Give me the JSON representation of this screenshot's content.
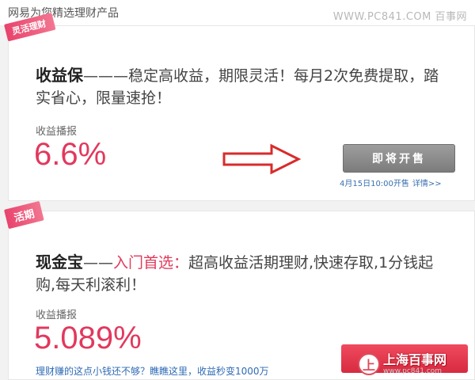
{
  "header": {
    "title": "网易为您精选理财产品",
    "watermark": "WWW.PC841.COM 百事网"
  },
  "products": [
    {
      "tag": "灵活理财",
      "name": "收益保",
      "dash": "———",
      "highlight": "",
      "description": "稳定高收益，期限灵活！每月2次免费提取，踏实省心，限量速抢！",
      "stat_label": "收益播报",
      "stat_value": "6.6%",
      "button_label": "即将开售",
      "sale_time": "4月15日10:00开售",
      "detail_link": "详情>>",
      "arrow_icon": "right-arrow-icon"
    },
    {
      "tag": "活期",
      "name": "现金宝",
      "dash": "——",
      "highlight": "入门首选：",
      "description": "超高收益活期理财,快速存取,1分钱起购,每天利滚利！",
      "stat_label": "收益播报",
      "stat_value": "5.089%",
      "promo": "理财赚的这点小钱还不够？瞧瞧这里，收益秒变1000万"
    }
  ],
  "watermark_br": {
    "logo": "上",
    "name": "上海百事网",
    "url": "www.pc841.com"
  },
  "colors": {
    "accent": "#e2385d",
    "link": "#2f6bb5",
    "button_gray": "#8a8a8a",
    "button_red": "#e03a4e"
  }
}
